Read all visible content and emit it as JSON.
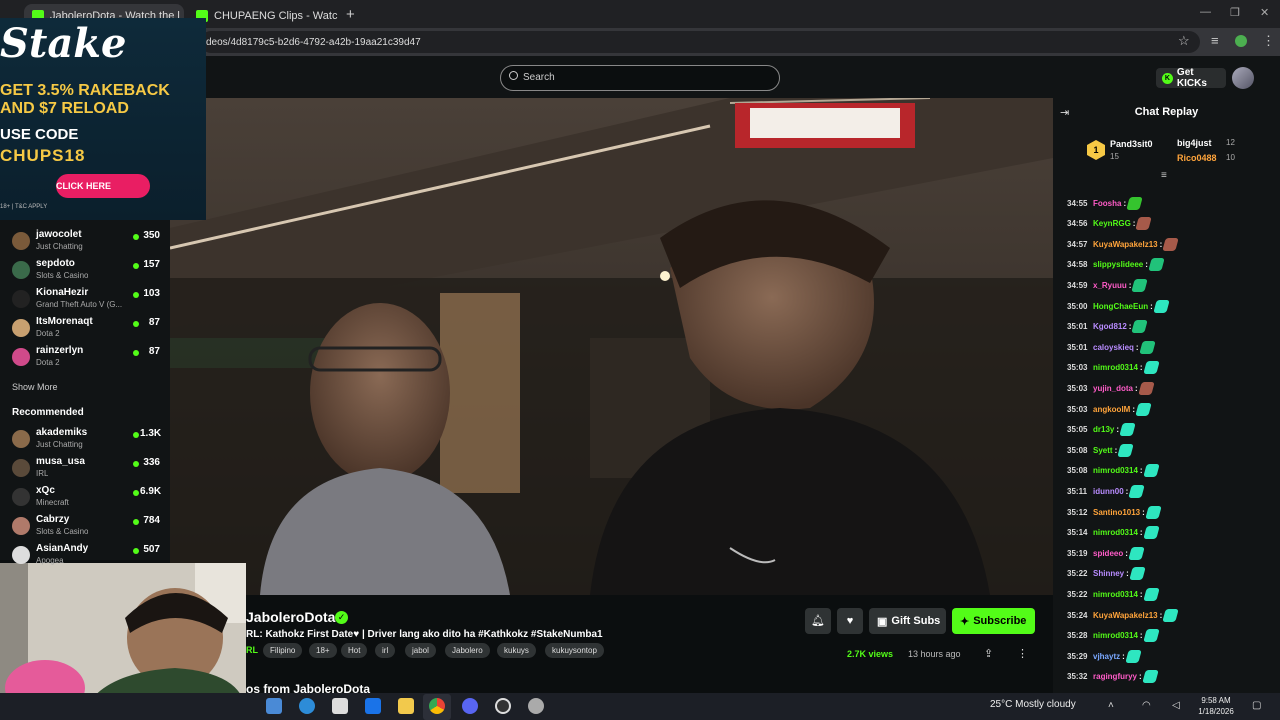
{
  "browser": {
    "tabs": [
      {
        "label": "JaboleroDota - Watch the l"
      },
      {
        "label": "CHUPAENG Clips - Watch Live"
      }
    ],
    "new_tab": "+",
    "url": "deos/4d8179c5-b2d6-4792-a42b-19aa21c39d47"
  },
  "header": {
    "search_placeholder": "Search",
    "get_kicks": "Get KICKs"
  },
  "ad": {
    "logo": "Stake",
    "line1": "GET 3.5% RAKEBACK",
    "line2": "AND $7 RELOAD",
    "line3": "USE CODE",
    "code": "CHUPS18",
    "button": "CLICK HERE",
    "terms": "18+ | T&C APPLY"
  },
  "sidebar": {
    "following": [
      {
        "name": "jawocolet",
        "category": "Just Chatting",
        "viewers": "350",
        "avatar": "#7a5a3a"
      },
      {
        "name": "sepdoto",
        "category": "Slots & Casino",
        "viewers": "157",
        "avatar": "#3a6a4a"
      },
      {
        "name": "KionaHezir",
        "category": "Grand Theft Auto V (G...",
        "viewers": "103",
        "avatar": "#222"
      },
      {
        "name": "ItsMorenaqt",
        "category": "Dota 2",
        "viewers": "87",
        "avatar": "#c8a070"
      },
      {
        "name": "rainzerlyn",
        "category": "Dota 2",
        "viewers": "87",
        "avatar": "#d04a8a"
      }
    ],
    "show_more": "Show More",
    "recommended_title": "Recommended",
    "recommended": [
      {
        "name": "akademiks",
        "category": "Just Chatting",
        "viewers": "1.3K",
        "avatar": "#8a6a4a"
      },
      {
        "name": "musa_usa",
        "category": "IRL",
        "viewers": "336",
        "avatar": "#5a4a3a"
      },
      {
        "name": "xQc",
        "category": "Minecraft",
        "viewers": "6.9K",
        "avatar": "#333"
      },
      {
        "name": "Cabrzy",
        "category": "Slots & Casino",
        "viewers": "784",
        "avatar": "#b07a6a"
      },
      {
        "name": "AsianAndy",
        "category": "Apogea",
        "viewers": "507",
        "avatar": "#ddd"
      }
    ]
  },
  "stream": {
    "streamer": "JaboleroDota",
    "title": "RL: Kathokz First Date♥ | Driver lang ako dito ha #Kathkokz #StakeNumba1",
    "category": "RL",
    "tags": [
      "Filipino",
      "18+",
      "Hot",
      "irl",
      "jabol",
      "Jabolero",
      "kukuys",
      "kukuysontop"
    ],
    "gift_subs": "Gift Subs",
    "subscribe": "Subscribe",
    "views": "2.7K views",
    "ago": "13 hours ago",
    "videos_from": "os from JaboleroDota"
  },
  "chat": {
    "title": "Chat Replay",
    "top_gifters": [
      {
        "rank": "1",
        "name": "Pand3sit0",
        "count": "15"
      },
      {
        "name": "big4just",
        "count": "12"
      },
      {
        "name": "Rico0488",
        "count": "10"
      }
    ],
    "messages": [
      {
        "time": "34:55",
        "user": "Foosha",
        "color": "#ff5cc8"
      },
      {
        "time": "34:56",
        "user": "KeynRGG",
        "color": "#53fc18"
      },
      {
        "time": "34:57",
        "user": "KuyaWapakelz13",
        "color": "#ffa43b"
      },
      {
        "time": "34:58",
        "user": "slippyslideee",
        "color": "#53fc18"
      },
      {
        "time": "34:59",
        "user": "x_Ryuuu",
        "color": "#ff5cc8"
      },
      {
        "time": "35:00",
        "user": "HongChaeEun",
        "color": "#53fc18"
      },
      {
        "time": "35:01",
        "user": "Kgod812",
        "color": "#b98cff"
      },
      {
        "time": "35:01",
        "user": "caloyskieq",
        "color": "#b98cff"
      },
      {
        "time": "35:03",
        "user": "nimrod0314",
        "color": "#53fc18"
      },
      {
        "time": "35:03",
        "user": "yujin_dota",
        "color": "#ff5cc8"
      },
      {
        "time": "35:03",
        "user": "angkoolM",
        "color": "#ffa43b"
      },
      {
        "time": "35:05",
        "user": "dr13y",
        "color": "#53fc18"
      },
      {
        "time": "35:08",
        "user": "Syett",
        "color": "#53fc18"
      },
      {
        "time": "35:08",
        "user": "nimrod0314",
        "color": "#53fc18"
      },
      {
        "time": "35:11",
        "user": "idunn00",
        "color": "#b98cff"
      },
      {
        "time": "35:12",
        "user": "Santino1013",
        "color": "#ffa43b"
      },
      {
        "time": "35:14",
        "user": "nimrod0314",
        "color": "#53fc18"
      },
      {
        "time": "35:19",
        "user": "spideeo",
        "color": "#ff5cc8"
      },
      {
        "time": "35:22",
        "user": "Shinney",
        "color": "#b98cff"
      },
      {
        "time": "35:22",
        "user": "nimrod0314",
        "color": "#53fc18"
      },
      {
        "time": "35:24",
        "user": "KuyaWapakelz13",
        "color": "#ffa43b"
      },
      {
        "time": "35:28",
        "user": "nimrod0314",
        "color": "#53fc18"
      },
      {
        "time": "35:29",
        "user": "vjhaytz",
        "color": "#7aa8ff"
      },
      {
        "time": "35:32",
        "user": "ragingfuryy",
        "color": "#ff5cc8"
      }
    ]
  },
  "taskbar": {
    "weather": "25°C  Mostly cloudy",
    "time": "9:58 AM",
    "date": "1/18/2026"
  },
  "colors": {
    "accent": "#53fc18",
    "chat_bg": "#111415",
    "page_bg": "#0b0e0f"
  }
}
